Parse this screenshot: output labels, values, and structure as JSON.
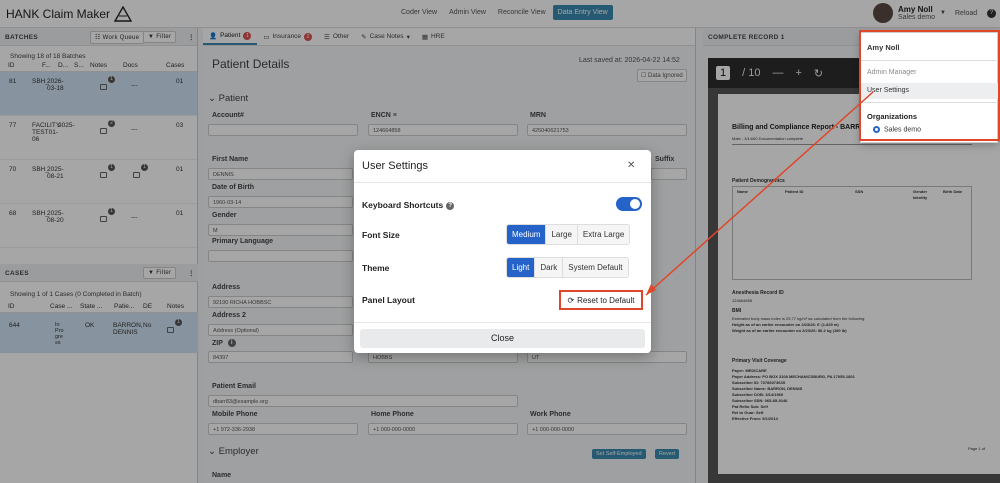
{
  "app": {
    "title": "HANK Claim Maker"
  },
  "nav": {
    "buttons": [
      "Coder View",
      "Admin View",
      "Reconcile View",
      "Data Entry View"
    ],
    "active": "Data Entry View"
  },
  "user": {
    "name": "Amy Noll",
    "org": "Sales demo",
    "reload": "Reload"
  },
  "batches": {
    "header": "BATCHES",
    "work_queue": "Work Queue",
    "filter": "Filter",
    "showing": "Showing 18 of 18 Batches",
    "columns": [
      "ID",
      "F...",
      "D...",
      "S...",
      "Notes",
      "Docs",
      "Cases"
    ],
    "rows": [
      {
        "id": "81",
        "f": "SBH_",
        "d": "2026-03-18",
        "notes": "1",
        "docs": "---",
        "cases": "01"
      },
      {
        "id": "77",
        "f": "FACILITY-TEST01-06",
        "d": "2025-",
        "notes": "2",
        "docs": "---",
        "cases": "03"
      },
      {
        "id": "70",
        "f": "SBH_",
        "d": "2025-08-21",
        "notes": "1",
        "docs": "1",
        "cases": "01"
      },
      {
        "id": "68",
        "f": "SBH_",
        "d": "2025-08-20",
        "notes": "1",
        "docs": "---",
        "cases": "01"
      }
    ]
  },
  "cases": {
    "header": "CASES",
    "filter": "Filter",
    "showing": "Showing 1 of 1 Cases (0 Completed in Batch)",
    "columns": [
      "ID",
      "Case ...",
      "State ...",
      "Patie...",
      "DE",
      "Notes"
    ],
    "row": {
      "id": "644",
      "case": "In Pro gre ss",
      "state": "OK",
      "patient": "BARRON, DENNIS",
      "de": "No",
      "notes": "1"
    }
  },
  "tabs": [
    {
      "label": "Patient",
      "badge": "1"
    },
    {
      "label": "Insurance",
      "badge": "2"
    },
    {
      "label": "Other",
      "badge": ""
    },
    {
      "label": "Case Notes",
      "badge": ""
    },
    {
      "label": "HRE",
      "badge": ""
    }
  ],
  "patient_details": {
    "title": "Patient Details",
    "last_saved": "Last saved at: 2026-04-22 14:52",
    "data_ignored": "Data Ignored",
    "section_patient": "Patient",
    "labels": {
      "account": "Account#",
      "encn": "ENCN",
      "mrn": "MRN",
      "first_name": "First Name",
      "suffix": "Suffix",
      "dob": "Date of Birth",
      "gender": "Gender",
      "primary_language": "Primary Language",
      "address": "Address",
      "address2": "Address 2",
      "zip": "ZIP",
      "email": "Patient Email",
      "mobile": "Mobile Phone",
      "home": "Home Phone",
      "work": "Work Phone"
    },
    "values": {
      "encn": "124664858",
      "mrn": "425040621753",
      "first_name": "DENNIS",
      "dob": "1960-03-14",
      "gender": "M",
      "address": "92190 RICHA HOBBSC",
      "address2": "Address (Optional)",
      "zip": "84397",
      "city": "HOBBS",
      "state": "UT",
      "email": "dbarr83@example.org",
      "mobile": "+1 972-336-2938",
      "home": "+1 000-000-0000",
      "work": "+1 000-000-0000"
    },
    "section_employer": "Employer",
    "employer_name_label": "Name",
    "btn_self_employed": "Set Self-Employed",
    "btn_revert": "Revert"
  },
  "record": {
    "header": "COMPLETE RECORD 1",
    "page": "1",
    "pages": "/ 10",
    "doc_title": "Billing and Compliance Report - BARRON",
    "doc_subtitle": "Male - 3/14/60 Documentation complete",
    "demographics": "Patient Demographics",
    "demo_cols": [
      "Name",
      "Patient ID",
      "SSN",
      "Gender Identity",
      "Birth Date"
    ],
    "anesthesia_heading": "Anesthesia Record ID",
    "anesthesia_id": "124664858",
    "bmi_heading": "BMI",
    "bmi_lines": [
      "Estimated body mass index is 25.77 kg/m² as calculated from the following:",
      "Height as of an earlier encounter on 2/23/26: 6' (1.829 m)",
      "Weight as of an earlier encounter on 2/23/26: 86.2 kg (190 lb)"
    ],
    "coverage_heading": "Primary Visit Coverage",
    "coverage_lines": [
      "Payer: MEDICARE",
      "Payer Address: PO BOX 3108 MECHANICSBURG, PA 17055-1801",
      "Subscriber ID: 7378607363S",
      "Subscriber Name: BARRON, DENNIS",
      "Subscriber DOB: 3/14/1960",
      "Subscriber SSN: 065-85-9146",
      "Pat Relto Sub: Self",
      "Rel to Guar: Self",
      "Effective From: 5/1/2014"
    ],
    "page_footer": "Page 1 of"
  },
  "modal": {
    "title": "User Settings",
    "keyboard_shortcuts": "Keyboard Shortcuts",
    "keyboard_enabled": true,
    "font_size": "Font Size",
    "font_options": [
      "Medium",
      "Large",
      "Extra Large"
    ],
    "font_selected": "Medium",
    "theme": "Theme",
    "theme_options": [
      "Light",
      "Dark",
      "System Default"
    ],
    "theme_selected": "Light",
    "panel_layout": "Panel Layout",
    "reset_label": "Reset to Default",
    "close_label": "Close"
  },
  "dropdown": {
    "name": "Amy Noll",
    "admin_manager": "Admin Manager",
    "user_settings": "User Settings",
    "organizations": "Organizations",
    "org": "Sales demo"
  },
  "colors": {
    "accent": "#2563c9",
    "highlight": "#e0462a",
    "selected_row": "#cfe2f3"
  }
}
